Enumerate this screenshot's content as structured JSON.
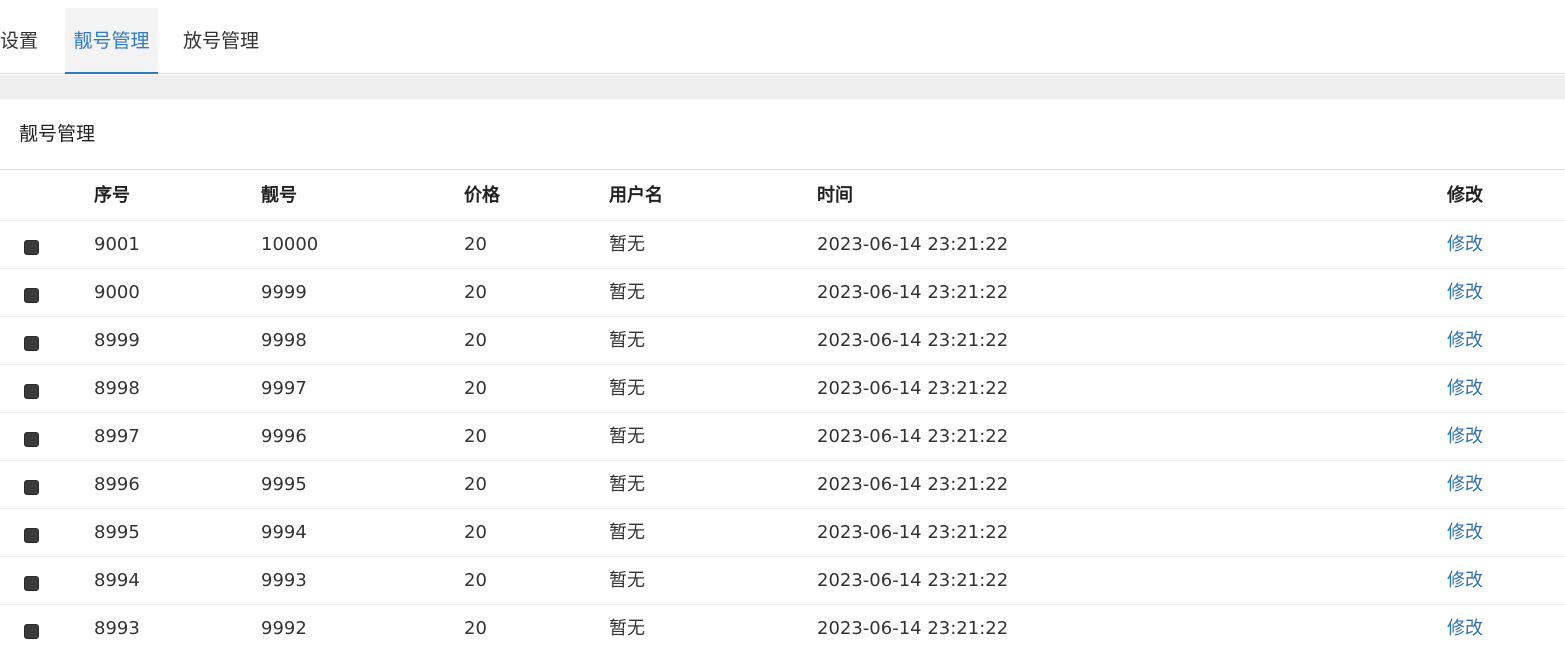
{
  "tabs": [
    {
      "label": "设置"
    },
    {
      "label": "靓号管理"
    },
    {
      "label": "放号管理"
    }
  ],
  "panel": {
    "title": "靓号管理"
  },
  "table": {
    "headers": {
      "seq": "序号",
      "number": "靓号",
      "price": "价格",
      "user": "用户名",
      "time": "时间",
      "edit": "修改"
    },
    "rows": [
      {
        "seq": "9001",
        "number": "10000",
        "price": "20",
        "user": "暂无",
        "time": "2023-06-14 23:21:22",
        "edit": "修改"
      },
      {
        "seq": "9000",
        "number": "9999",
        "price": "20",
        "user": "暂无",
        "time": "2023-06-14 23:21:22",
        "edit": "修改"
      },
      {
        "seq": "8999",
        "number": "9998",
        "price": "20",
        "user": "暂无",
        "time": "2023-06-14 23:21:22",
        "edit": "修改"
      },
      {
        "seq": "8998",
        "number": "9997",
        "price": "20",
        "user": "暂无",
        "time": "2023-06-14 23:21:22",
        "edit": "修改"
      },
      {
        "seq": "8997",
        "number": "9996",
        "price": "20",
        "user": "暂无",
        "time": "2023-06-14 23:21:22",
        "edit": "修改"
      },
      {
        "seq": "8996",
        "number": "9995",
        "price": "20",
        "user": "暂无",
        "time": "2023-06-14 23:21:22",
        "edit": "修改"
      },
      {
        "seq": "8995",
        "number": "9994",
        "price": "20",
        "user": "暂无",
        "time": "2023-06-14 23:21:22",
        "edit": "修改"
      },
      {
        "seq": "8994",
        "number": "9993",
        "price": "20",
        "user": "暂无",
        "time": "2023-06-14 23:21:22",
        "edit": "修改"
      },
      {
        "seq": "8993",
        "number": "9992",
        "price": "20",
        "user": "暂无",
        "time": "2023-06-14 23:21:22",
        "edit": "修改"
      }
    ]
  },
  "colors": {
    "accent": "#2f7ac5",
    "link": "#2f6fb0",
    "band": "#efefef"
  }
}
